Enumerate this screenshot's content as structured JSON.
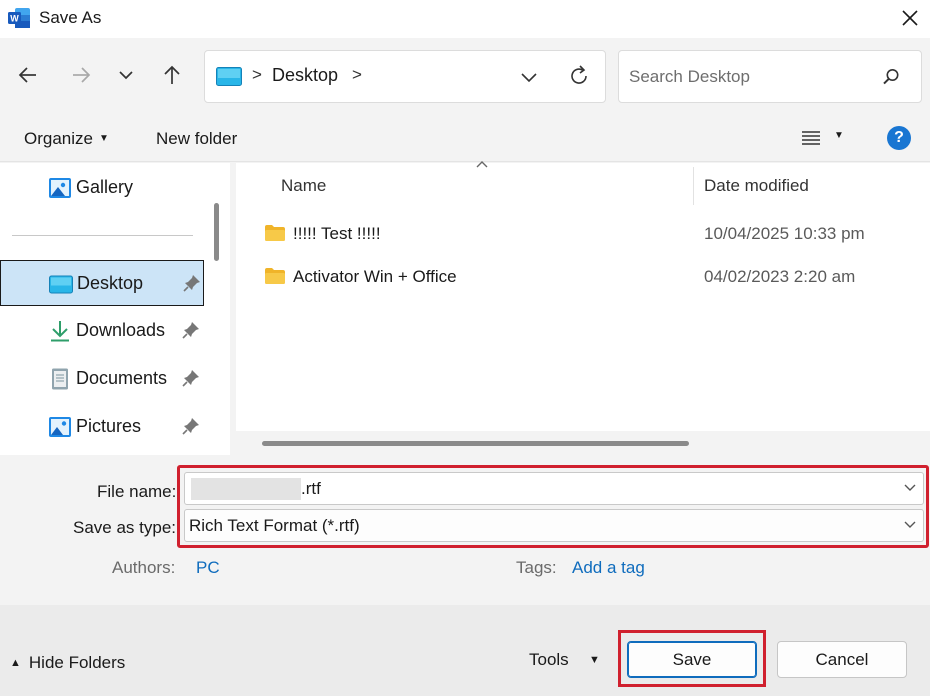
{
  "window": {
    "title": "Save As",
    "app_icon": "word-icon",
    "close_icon": "close-icon"
  },
  "nav": {
    "back_icon": "arrow-left-icon",
    "forward_icon": "arrow-right-icon",
    "recent_icon": "chevron-down-icon",
    "up_icon": "arrow-up-icon",
    "address": {
      "location_icon": "desktop-icon",
      "separator": ">",
      "crumb": "Desktop",
      "trailing_separator": ">",
      "dropdown_icon": "chevron-down-icon",
      "refresh_icon": "refresh-icon"
    },
    "search": {
      "placeholder": "Search Desktop",
      "value": "",
      "icon": "search-icon"
    }
  },
  "command_bar": {
    "organize_label": "Organize",
    "new_folder_label": "New folder",
    "view_icon": "list-view-icon",
    "help_label": "?"
  },
  "sidebar": {
    "items": [
      {
        "label": "Gallery",
        "icon": "gallery-icon",
        "pinned": false,
        "selected": false
      },
      {
        "label": "Desktop",
        "icon": "desktop-icon",
        "pinned": true,
        "selected": true
      },
      {
        "label": "Downloads",
        "icon": "download-icon",
        "pinned": true,
        "selected": false
      },
      {
        "label": "Documents",
        "icon": "documents-icon",
        "pinned": true,
        "selected": false
      },
      {
        "label": "Pictures",
        "icon": "pictures-icon",
        "pinned": true,
        "selected": false
      }
    ]
  },
  "file_list": {
    "columns": {
      "name": "Name",
      "date_modified": "Date modified"
    },
    "sort": {
      "column": "name",
      "direction": "ascending"
    },
    "rows": [
      {
        "name": "!!!!! Test !!!!!",
        "date_modified": "10/04/2025 10:33 pm",
        "type": "folder"
      },
      {
        "name": "Activator Win + Office",
        "date_modified": "04/02/2023 2:20 am",
        "type": "folder"
      }
    ]
  },
  "form": {
    "file_name_label": "File name:",
    "file_name_suffix": ".rtf",
    "save_as_type_label": "Save as type:",
    "save_as_type_value": "Rich Text Format (*.rtf)",
    "authors_label": "Authors:",
    "authors_value": "PC",
    "tags_label": "Tags:",
    "tags_value": "Add a tag",
    "highlight_color": "#d0202e"
  },
  "footer": {
    "hide_folders_label": "Hide Folders",
    "tools_label": "Tools",
    "save_label": "Save",
    "cancel_label": "Cancel"
  },
  "colors": {
    "accent": "#0f6cbd",
    "selected_bg": "#cce4f7",
    "help_bg": "#1976d2",
    "folder": "#f7c948"
  }
}
